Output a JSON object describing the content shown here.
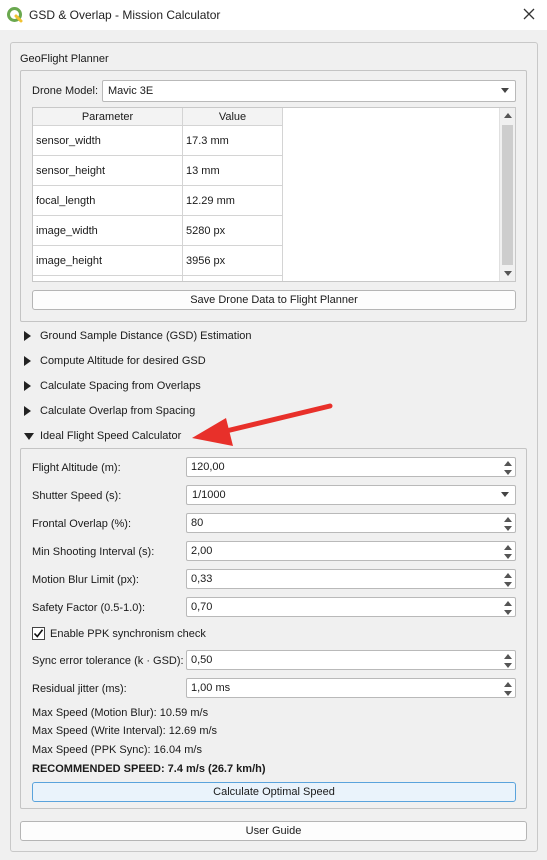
{
  "window": {
    "title": "GSD & Overlap - Mission Calculator",
    "app_icon": "qgis-icon",
    "close_icon": "close-icon"
  },
  "geoflight": {
    "group_title": "GeoFlight Planner",
    "drone_model_label": "Drone Model:",
    "drone_model_value": "Mavic 3E",
    "table": {
      "headers": [
        "Parameter",
        "Value"
      ],
      "rows": [
        [
          "sensor_width",
          "17.3 mm"
        ],
        [
          "sensor_height",
          "13 mm"
        ],
        [
          "focal_length",
          "12.29 mm"
        ],
        [
          "image_width",
          "5280 px"
        ],
        [
          "image_height",
          "3956 px"
        ]
      ]
    },
    "save_button": "Save Drone Data to Flight Planner"
  },
  "sections": [
    {
      "label": "Ground Sample Distance (GSD) Estimation",
      "expanded": false
    },
    {
      "label": "Compute Altitude for desired GSD",
      "expanded": false
    },
    {
      "label": "Calculate Spacing from Overlaps",
      "expanded": false
    },
    {
      "label": "Calculate Overlap from Spacing",
      "expanded": false
    },
    {
      "label": "Ideal Flight Speed Calculator",
      "expanded": true
    }
  ],
  "speed_calc": {
    "fields": [
      {
        "label": "Flight Altitude (m):",
        "value": "120,00",
        "type": "spin"
      },
      {
        "label": "Shutter Speed (s):",
        "value": "1/1000",
        "type": "combo"
      },
      {
        "label": "Frontal Overlap (%):",
        "value": "80",
        "type": "spin"
      },
      {
        "label": "Min Shooting Interval (s):",
        "value": "2,00",
        "type": "spin"
      },
      {
        "label": "Motion Blur Limit (px):",
        "value": "0,33",
        "type": "spin"
      },
      {
        "label": "Safety Factor (0.5-1.0):",
        "value": "0,70",
        "type": "spin"
      }
    ],
    "ppk_check_label": "Enable PPK synchronism check",
    "ppk_checked": true,
    "ppk_fields": [
      {
        "label": "Sync error tolerance (k · GSD):",
        "value": "0,50"
      },
      {
        "label": "Residual jitter (ms):",
        "value": "1,00 ms"
      }
    ],
    "results": [
      "Max Speed (Motion Blur): 10.59 m/s",
      "Max Speed (Write Interval): 12.69 m/s",
      "Max Speed (PPK Sync): 16.04 m/s"
    ],
    "recommended": "RECOMMENDED SPEED: 7.4 m/s (26.7 km/h)",
    "calc_button": "Calculate Optimal Speed"
  },
  "user_guide_button": "User Guide",
  "colors": {
    "annotation_arrow": "#e8302a",
    "primary_button_border": "#5aa3dc"
  }
}
